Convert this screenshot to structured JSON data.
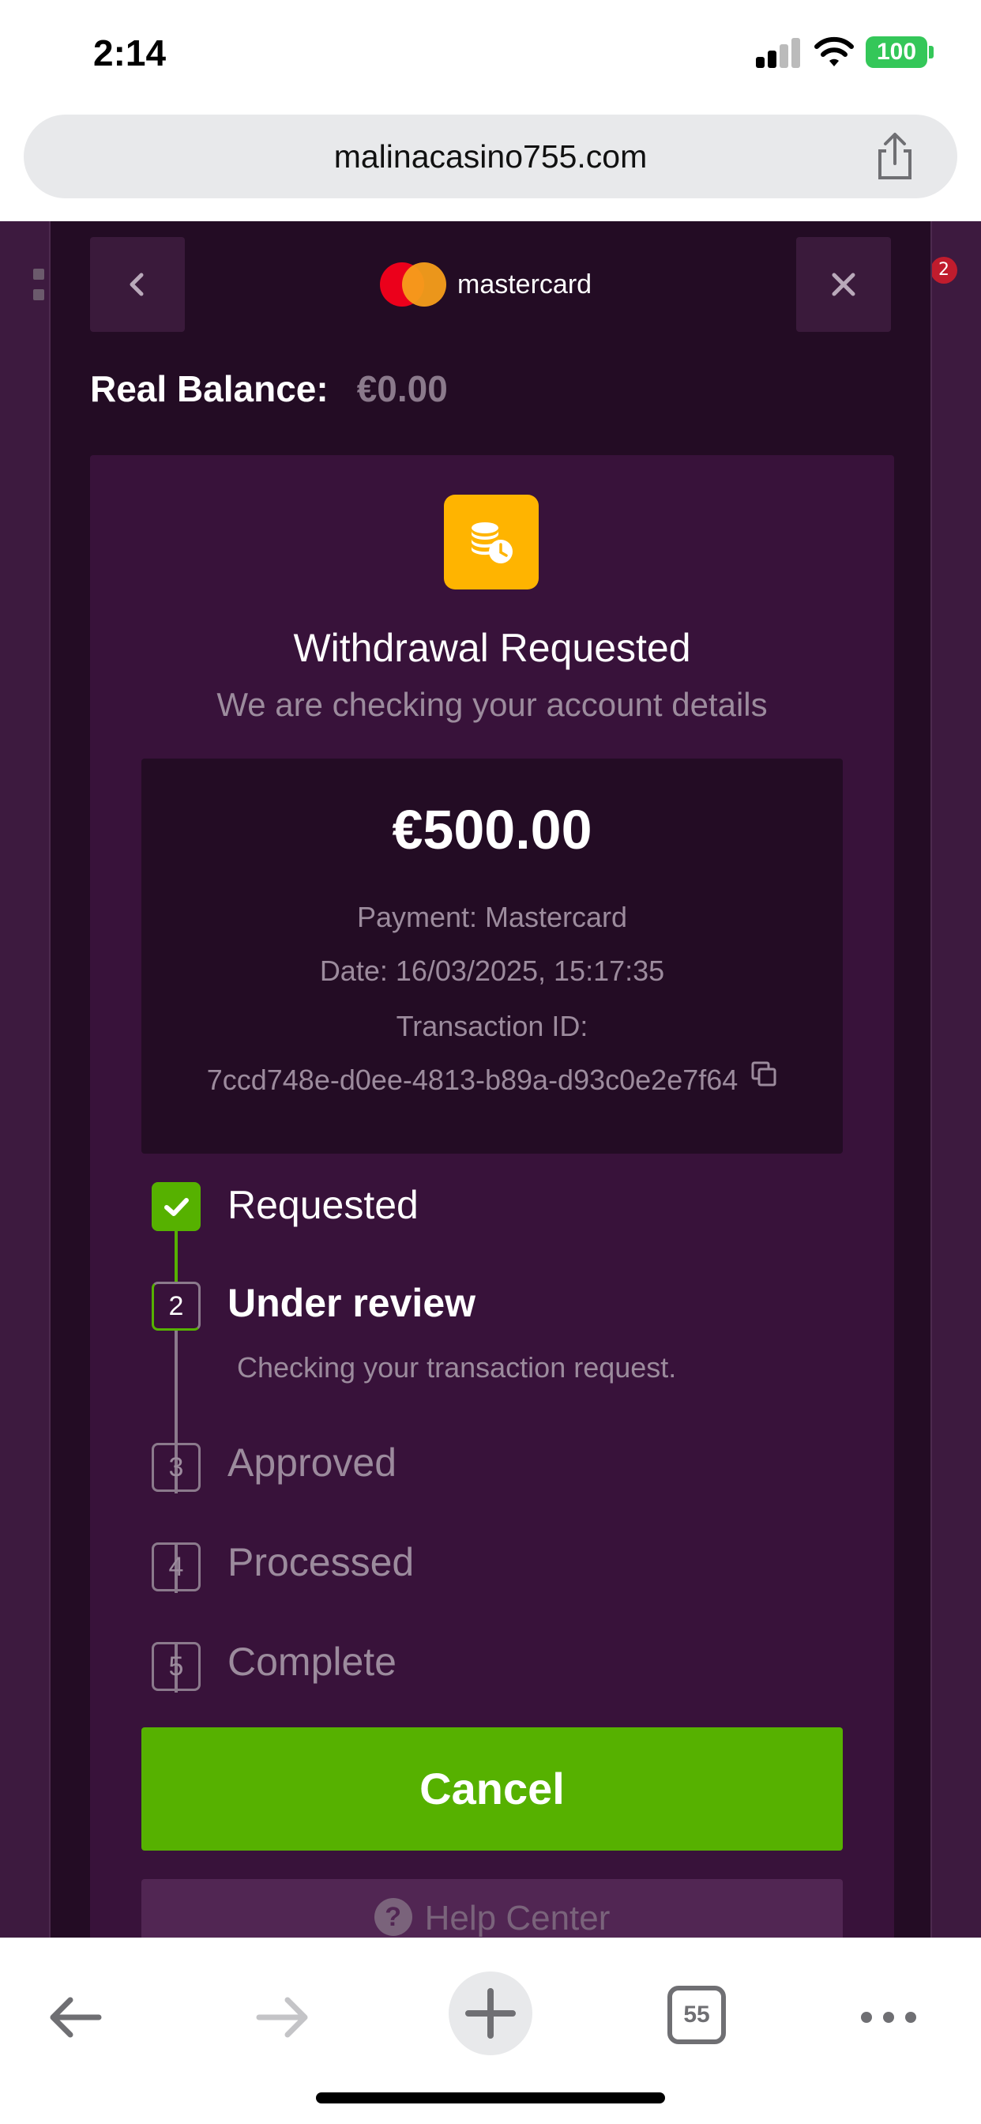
{
  "status_bar": {
    "time": "2:14",
    "battery": "100"
  },
  "browser": {
    "url": "malinacasino755.com",
    "tabs_count": "55"
  },
  "background": {
    "badge": "2"
  },
  "modal": {
    "brand": "mastercard",
    "balance_label": "Real Balance:",
    "balance_value": "€0.00",
    "title": "Withdrawal Requested",
    "subtitle": "We are checking your account details",
    "amount": "€500.00",
    "payment": "Payment: Mastercard",
    "date": "Date: 16/03/2025, 15:17:35",
    "transaction_label": "Transaction ID:",
    "transaction_id": "7ccd748e-d0ee-4813-b89a-d93c0e2e7f64",
    "steps": [
      {
        "number": "1",
        "label": "Requested",
        "state": "done"
      },
      {
        "number": "2",
        "label": "Under review",
        "state": "active",
        "description": "Checking your transaction request."
      },
      {
        "number": "3",
        "label": "Approved",
        "state": "pending"
      },
      {
        "number": "4",
        "label": "Processed",
        "state": "pending"
      },
      {
        "number": "5",
        "label": "Complete",
        "state": "pending"
      }
    ],
    "cancel_label": "Cancel",
    "help_label": "Help Center",
    "help_icon_glyph": "?"
  },
  "colors": {
    "accent_green": "#56b100",
    "modal_bg": "#230c24",
    "card_bg": "#38123a",
    "coin_icon": "#ffb400",
    "mastercard_red": "#eb001b",
    "mastercard_orange": "#f79e1b"
  },
  "icons": {
    "back": "chevron-left-icon",
    "close": "close-icon",
    "coin": "coin-stack-clock-icon",
    "copy": "copy-icon",
    "share": "share-icon",
    "help": "question-icon"
  }
}
